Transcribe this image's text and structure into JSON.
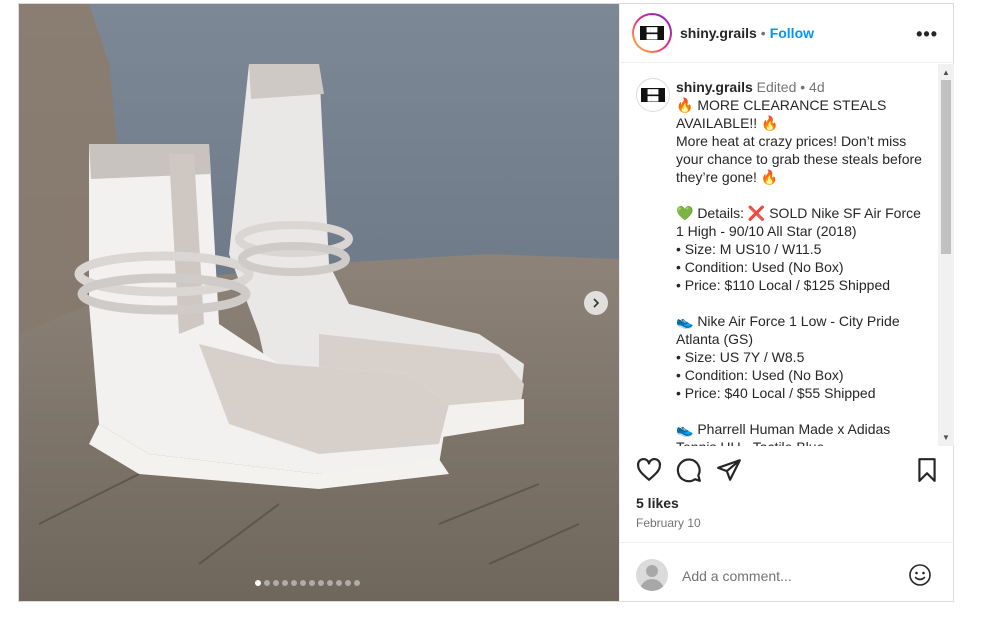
{
  "header": {
    "username": "shiny.grails",
    "separator": "•",
    "follow_label": "Follow",
    "more_icon": "more-horizontal-icon"
  },
  "caption": {
    "username": "shiny.grails",
    "meta": "Edited • 4d",
    "text": "🔥 MORE CLEARANCE STEALS AVAILABLE!! 🔥\nMore heat at crazy prices! Don’t miss your chance to grab these steals before they’re gone! 🔥\n\n💚 Details: ❌ SOLD Nike SF Air Force 1 High - 90/10 All Star (2018)\n• Size: M US10 / W11.5\n• Condition: Used (No Box)\n• Price: $110 Local / $125 Shipped\n\n👟 Nike Air Force 1 Low - City Pride Atlanta (GS)\n• Size: US 7Y / W8.5\n• Condition: Used (No Box)\n• Price: $40 Local / $55 Shipped\n\n👟 Pharrell Human Made x Adidas Tennis HU - Tactile Blue"
  },
  "media": {
    "carousel_dots": 12,
    "active_dot": 0
  },
  "actions": {
    "like_icon": "heart-icon",
    "comment_icon": "comment-icon",
    "share_icon": "send-icon",
    "save_icon": "bookmark-icon"
  },
  "likes": "5 likes",
  "date": "February 10",
  "add_comment": {
    "placeholder": "Add a comment..."
  },
  "colors": {
    "accent": "#0095f6",
    "text": "#262626",
    "muted": "#737373",
    "border": "#dbdbdb"
  }
}
